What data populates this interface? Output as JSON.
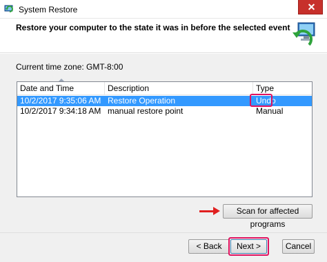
{
  "window": {
    "title": "System Restore",
    "icon": "system-restore-icon"
  },
  "header": {
    "text": "Restore your computer to the state it was in before the selected event",
    "icon": "system-restore-graphic-icon"
  },
  "timezone": "Current time zone: GMT-8:00",
  "table": {
    "columns": [
      "Date and Time",
      "Description",
      "Type"
    ],
    "rows": [
      {
        "date": "10/2/2017 9:35:06 AM",
        "description": "Restore Operation",
        "type": "Undo",
        "selected": true
      },
      {
        "date": "10/2/2017 9:34:18 AM",
        "description": "manual restore point",
        "type": "Manual",
        "selected": false
      }
    ]
  },
  "buttons": {
    "scan": "Scan for affected programs",
    "back": "< Back",
    "next": "Next >",
    "cancel": "Cancel"
  },
  "colors": {
    "selection": "#3399ff",
    "highlight": "#e0115f",
    "arrow": "#e02020",
    "close": "#c7302b"
  }
}
